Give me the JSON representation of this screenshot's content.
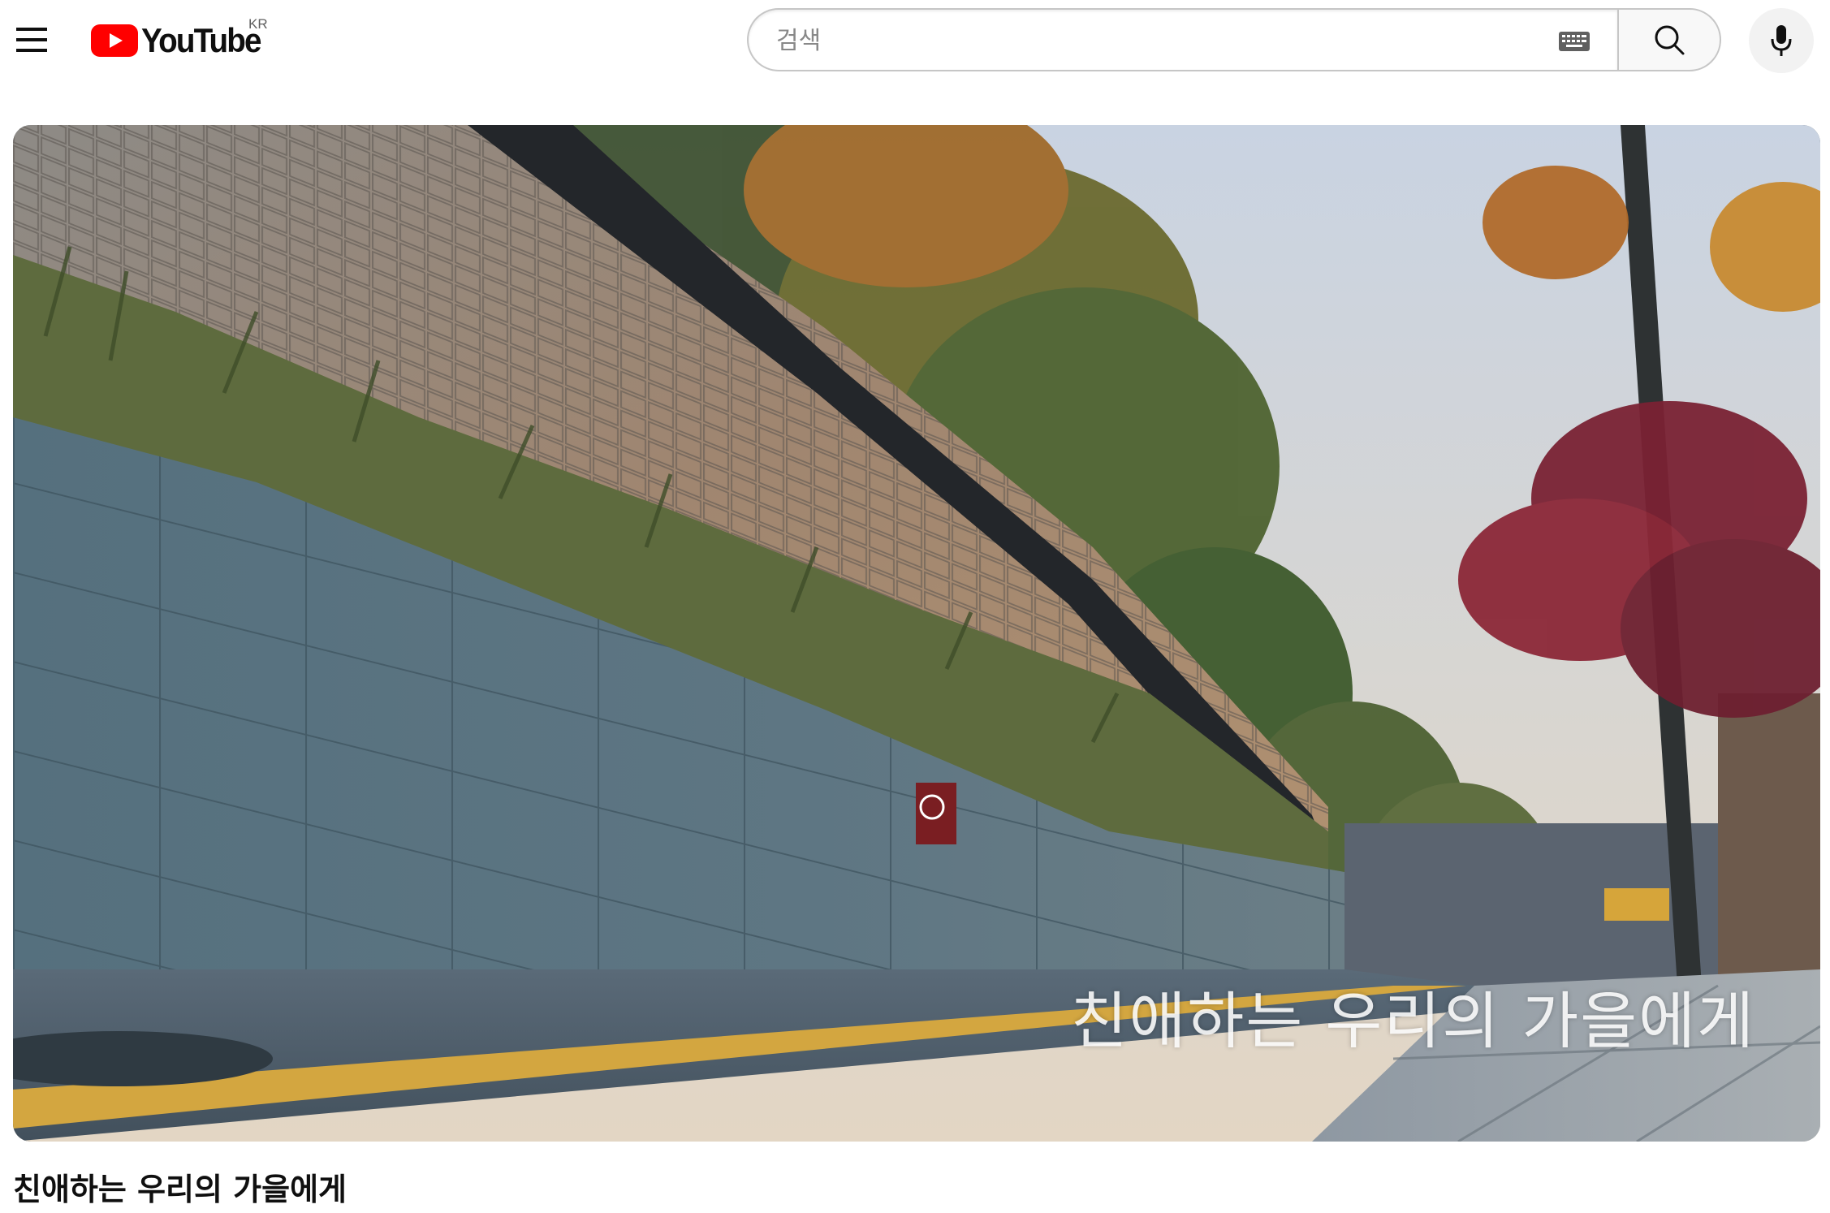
{
  "masthead": {
    "logo_text": "YouTube",
    "country_code": "KR",
    "search_placeholder": "검색",
    "icons": {
      "menu": "hamburger-menu-icon",
      "keyboard": "keyboard-icon",
      "search": "search-icon",
      "mic": "microphone-icon"
    },
    "brand_color": "#ff0000"
  },
  "video": {
    "overlay_caption": "친애하는 우리의 가을에게",
    "title": "친애하는 우리의 가을에게"
  }
}
